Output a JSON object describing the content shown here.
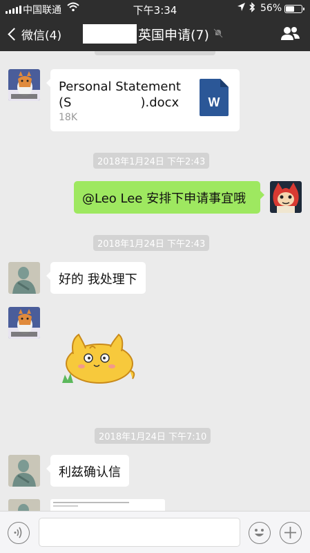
{
  "status_bar": {
    "carrier": "中国联通",
    "time": "下午3:34",
    "battery_percent": "56%",
    "battery_level": 0.56,
    "icons": [
      "signal-icon",
      "wifi-icon",
      "location-icon",
      "bluetooth-icon",
      "battery-icon"
    ]
  },
  "nav": {
    "back_label": "微信(4)",
    "title_suffix": "英国申请(7)",
    "icons": [
      "chevron-left-icon",
      "mute-icon",
      "group-members-icon"
    ]
  },
  "messages": {
    "file": {
      "name_line1": "Personal Statement",
      "name_prefix": "(S",
      "name_suffix": ").docx",
      "size": "18K",
      "icon": "word-document-icon",
      "icon_letter": "W"
    },
    "ts1": "2018年1月24日 下午2:43",
    "out_text": "@Leo Lee 安排下申请事宜哦",
    "ts2": "2018年1月24日 下午2:43",
    "in_text1": "好的 我处理下",
    "sticker": "cat-sticker",
    "ts3": "2018年1月24日 下午7:10",
    "in_text2": "利兹确认信"
  },
  "input_bar": {
    "icons": [
      "voice-icon",
      "emoji-icon",
      "plus-icon"
    ]
  },
  "colors": {
    "nav_bg": "#2e2e2e",
    "chat_bg": "#ebebeb",
    "outgoing_bubble": "#9ee860",
    "word_blue": "#2b5797"
  }
}
